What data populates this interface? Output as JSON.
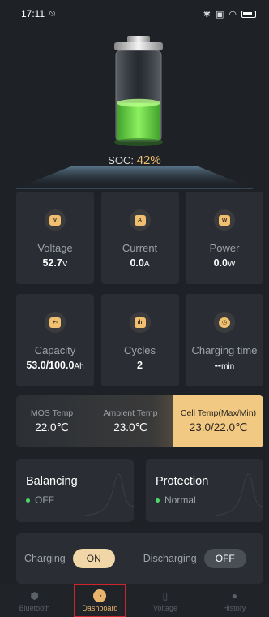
{
  "status_bar": {
    "time": "17:11",
    "icons": [
      "alarm-off-icon",
      "bluetooth-icon",
      "sim-icon",
      "wifi-icon",
      "battery-icon"
    ]
  },
  "battery": {
    "soc_label": "SOC:",
    "soc_value": "42%",
    "fill_fraction": 0.42,
    "fill_color": "#6be04a"
  },
  "metrics": [
    {
      "id": "voltage",
      "label": "Voltage",
      "value": "52.7",
      "unit": "V",
      "icon": "voltage-meter-icon",
      "glyph": "V"
    },
    {
      "id": "current",
      "label": "Current",
      "value": "0.0",
      "unit": "A",
      "icon": "current-meter-icon",
      "glyph": "A"
    },
    {
      "id": "power",
      "label": "Power",
      "value": "0.0",
      "unit": "W",
      "icon": "power-meter-icon",
      "glyph": "W"
    },
    {
      "id": "capacity",
      "label": "Capacity",
      "value": "53.0/100.0",
      "unit": "Ah",
      "icon": "battery-capacity-icon",
      "glyph": "+-"
    },
    {
      "id": "cycles",
      "label": "Cycles",
      "value": "2",
      "unit": "",
      "icon": "cycles-chart-icon",
      "glyph": "ılı"
    },
    {
      "id": "charging_time",
      "label": "Charging time",
      "value": "--",
      "unit": "min",
      "icon": "clock-icon",
      "glyph": "◷"
    }
  ],
  "temps": [
    {
      "label": "MOS Temp",
      "value": "22.0℃"
    },
    {
      "label": "Ambient Temp",
      "value": "23.0℃"
    },
    {
      "label": "Cell Temp(Max/Min)",
      "value": "23.0/22.0℃"
    }
  ],
  "cards": {
    "balancing": {
      "title": "Balancing",
      "status": "OFF"
    },
    "protection": {
      "title": "Protection",
      "status": "Normal"
    }
  },
  "control": {
    "charging_label": "Charging",
    "charging_state": "ON",
    "discharging_label": "Discharging",
    "discharging_state": "OFF"
  },
  "nav": [
    {
      "label": "Bluetooth",
      "icon": "bluetooth-shield-icon",
      "active": false
    },
    {
      "label": "Dashboard",
      "icon": "dashboard-icon",
      "active": true
    },
    {
      "label": "Voltage",
      "icon": "battery-voltage-icon",
      "active": false
    },
    {
      "label": "History",
      "icon": "user-history-icon",
      "active": false
    }
  ],
  "colors": {
    "background": "#1e2227",
    "tile": "#2a2e34",
    "accent": "#f0c070",
    "status_ok": "#4cd964"
  }
}
